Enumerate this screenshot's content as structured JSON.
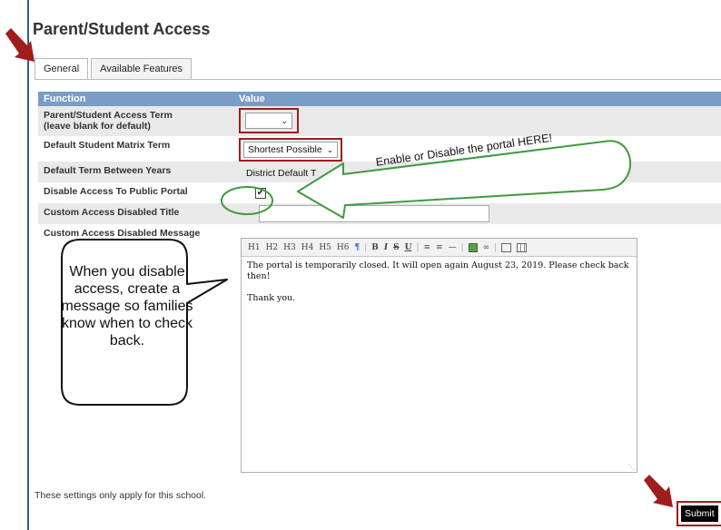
{
  "page": {
    "title": "Parent/Student Access"
  },
  "tabs": [
    {
      "label": "General",
      "active": true
    },
    {
      "label": "Available Features",
      "active": false
    }
  ],
  "table": {
    "headers": {
      "function": "Function",
      "value": "Value"
    },
    "rows": [
      {
        "label_line1": "Parent/Student Access Term",
        "label_line2": "(leave blank for default)",
        "value": ""
      },
      {
        "label": "Default Student Matrix Term",
        "value": "Shortest Possible"
      },
      {
        "label": "Default Term Between Years",
        "value": "District Default T"
      },
      {
        "label": "Disable Access To Public Portal",
        "checked": true
      },
      {
        "label": "Custom Access Disabled Title",
        "value": ""
      },
      {
        "label": "Custom Access Disabled Message"
      }
    ]
  },
  "editor": {
    "toolbar": [
      "H1",
      "H2",
      "H3",
      "H4",
      "H5",
      "H6",
      "¶",
      "B",
      "I",
      "S",
      "U",
      "bulleted-list-icon",
      "numbered-list-icon",
      "horizontal-rule-icon",
      "image-icon",
      "link-icon",
      "frame-icon",
      "table-icon"
    ],
    "paragraph_1": "The portal is temporarily closed. It will open again August 23, 2019. Please check back then!",
    "paragraph_2": "Thank you."
  },
  "footer": {
    "note": "These settings only apply for this school.",
    "submit_label": "Submit"
  },
  "annotations": {
    "arrow_callout": "Enable or Disable the portal HERE!",
    "bubble_callout": "When you disable access, create a message so families know when to check back."
  },
  "colors": {
    "accent_red": "#a01d1d",
    "callout_green": "#3f9a3f",
    "header_blue": "#7b9cc4"
  }
}
